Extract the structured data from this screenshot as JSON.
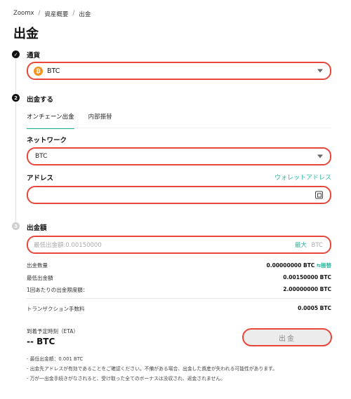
{
  "breadcrumb": {
    "items": [
      "Zoomx",
      "資産概要",
      "出金"
    ],
    "separator": "/"
  },
  "page": {
    "title": "出金"
  },
  "steps": {
    "currency": {
      "label": "通貨",
      "selected": "BTC",
      "coin_symbol": "₿",
      "coin_color": "#f7931a"
    },
    "withdraw": {
      "step_number": "2",
      "label": "出金する",
      "tabs": [
        "オンチェーン出金",
        "内部振替"
      ],
      "network_label": "ネットワーク",
      "network_value": "BTC",
      "address_label": "アドレス",
      "wallet_address_link": "ウォレットアドレス",
      "address_value": ""
    },
    "amount": {
      "step_number": "3",
      "label": "出金額",
      "placeholder": "最低出金額:0.00150000",
      "max_label": "最大",
      "currency": "BTC"
    }
  },
  "info": {
    "withdraw_qty_label": "出金数量",
    "withdraw_qty_value": "0.00000000 BTC",
    "transfer_link": "⇆振替",
    "min_withdraw_label": "最低出金額",
    "min_withdraw_value": "0.00150000 BTC",
    "per_tx_limit_label": "1回あたりの出金限度額：",
    "per_tx_limit_value": "2.00000000 BTC",
    "fee_label": "トランザクション手数料",
    "fee_value": "0.0005 BTC"
  },
  "eta": {
    "label": "到着予定時刻（ETA）",
    "value": "-- BTC"
  },
  "submit": {
    "label": "出金"
  },
  "notes": [
    "- 最低出金額：0.001 BTC",
    "- 出金先アドレスが有効であることをご確認ください。不備がある場合、出金した資産が失われる可能性があります。",
    "- 万が一出金手続きがなされると、受け取った全てのボーナスは没収され、返金されません。"
  ],
  "colors": {
    "accent_green": "#2fb99e",
    "highlight_red": "#e8473a",
    "btc_orange": "#f7931a"
  }
}
